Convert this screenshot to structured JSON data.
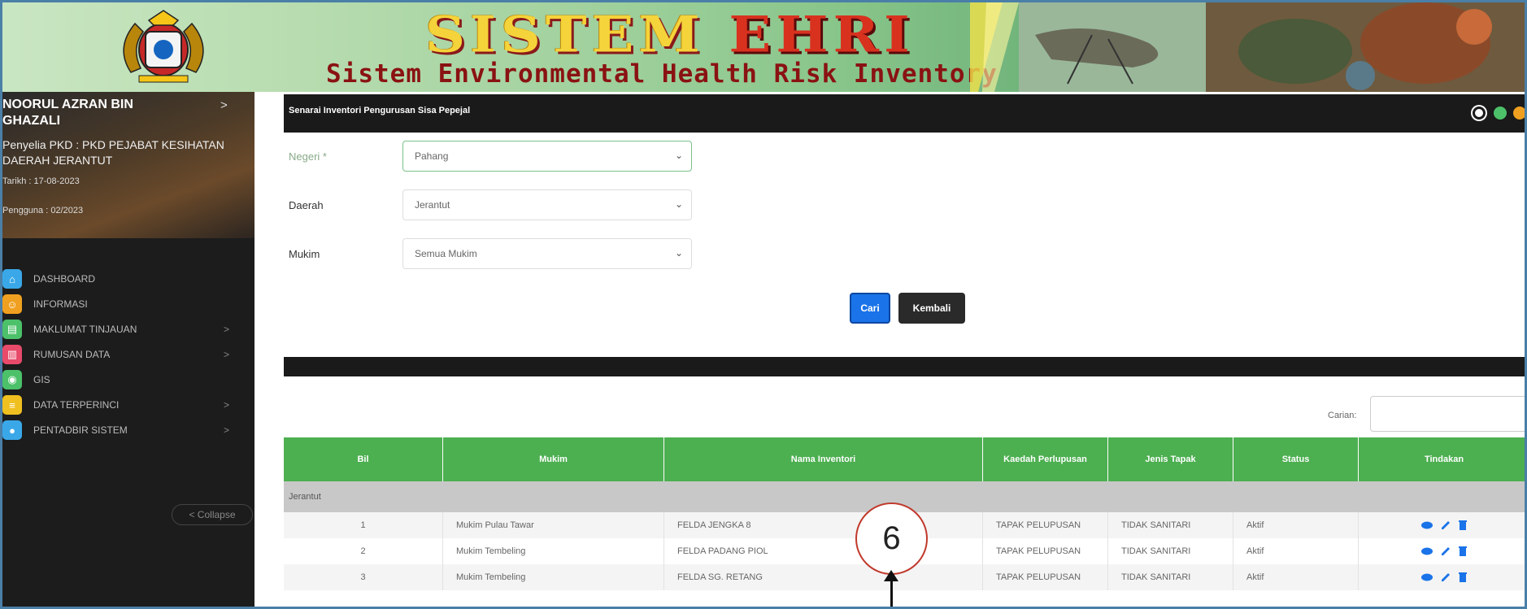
{
  "banner": {
    "title_part1": "SISTEM ",
    "title_part2": "EHRI",
    "subtitle": "Sistem Environmental Health Risk Inventory"
  },
  "sidebar": {
    "user_name": "NOORUL AZRAN BIN GHAZALI",
    "role": "Penyelia PKD : PKD PEJABAT KESIHATAN DAERAH JERANTUT",
    "date": "Tarikh : 17-08-2023",
    "login": "Pengguna : 02/2023",
    "items": [
      {
        "label": "DASHBOARD",
        "icon": "home-icon",
        "color": "#3aa8e8",
        "has_arrow": false
      },
      {
        "label": "INFORMASI",
        "icon": "info-icon",
        "color": "#f0a020",
        "has_arrow": false
      },
      {
        "label": "MAKLUMAT TINJAUAN",
        "icon": "clipboard-icon",
        "color": "#4cc16a",
        "has_arrow": true
      },
      {
        "label": "RUMUSAN DATA",
        "icon": "chart-icon",
        "color": "#e84a6a",
        "has_arrow": true
      },
      {
        "label": "GIS",
        "icon": "globe-icon",
        "color": "#4cc16a",
        "has_arrow": false
      },
      {
        "label": "DATA TERPERINCI",
        "icon": "list-icon",
        "color": "#f0c020",
        "has_arrow": true
      },
      {
        "label": "PENTADBIR SISTEM",
        "icon": "admin-icon",
        "color": "#3aa8e8",
        "has_arrow": true
      }
    ],
    "collapse_label": "< Collapse"
  },
  "main": {
    "page_title": "Senarai Inventori Pengurusan Sisa Pepejal",
    "form": {
      "negeri_label": "Negeri *",
      "negeri_value": "Pahang",
      "daerah_label": "Daerah",
      "daerah_value": "Jerantut",
      "mukim_label": "Mukim",
      "mukim_value": "Semua Mukim"
    },
    "cari_label": "Cari",
    "kembali_label": "Kembali",
    "search_label": "Carian:",
    "table": {
      "headers": [
        "Bil",
        "Mukim",
        "Nama Inventori",
        "Kaedah Perlupusan",
        "Jenis Tapak",
        "Status",
        "Tindakan"
      ],
      "group": "Jerantut",
      "rows": [
        {
          "bil": "1",
          "mukim": "Mukim Pulau Tawar",
          "nama": "FELDA JENGKA 8",
          "kaedah": "TAPAK PELUPUSAN",
          "jenis": "TIDAK SANITARI",
          "status": "Aktif"
        },
        {
          "bil": "2",
          "mukim": "Mukim Tembeling",
          "nama": "FELDA PADANG PIOL",
          "kaedah": "TAPAK PELUPUSAN",
          "jenis": "TIDAK SANITARI",
          "status": "Aktif"
        },
        {
          "bil": "3",
          "mukim": "Mukim Tembeling",
          "nama": "FELDA SG. RETANG",
          "kaedah": "TAPAK PELUPUSAN",
          "jenis": "TIDAK SANITARI",
          "status": "Aktif"
        }
      ]
    }
  },
  "callout": {
    "number": "6"
  }
}
